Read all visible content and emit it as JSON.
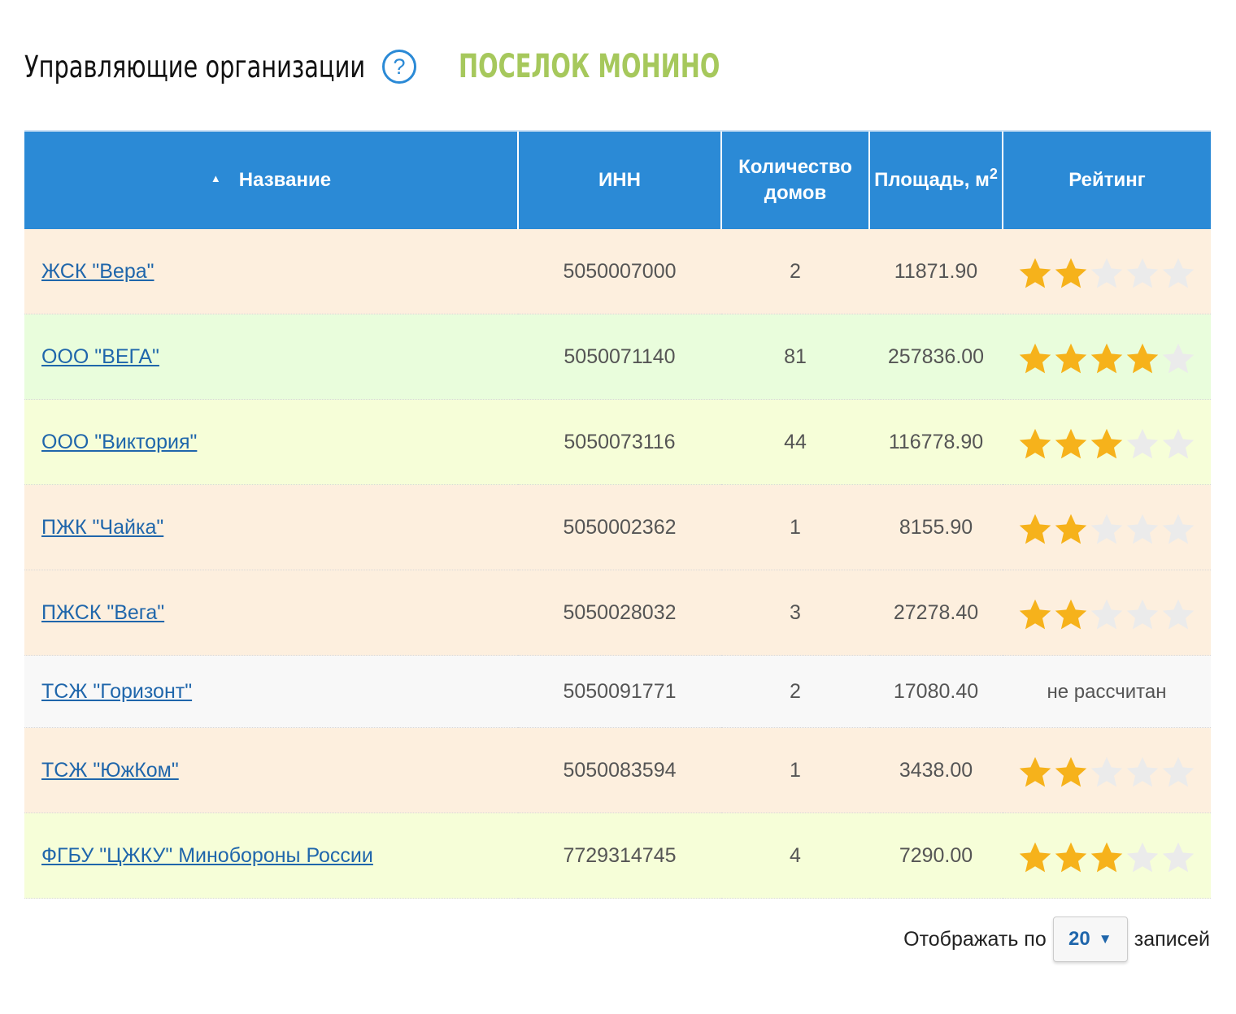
{
  "header": {
    "title": "Управляющие организации",
    "help_icon": "?",
    "locality": "ПОСЕЛОК МОНИНО"
  },
  "table": {
    "columns": {
      "name": "Название",
      "inn": "ИНН",
      "houses": "Количество домов",
      "area": "Площадь, м",
      "area_sup": "2",
      "rating": "Рейтинг"
    },
    "sort_indicator": "▲",
    "rows": [
      {
        "name": "ЖСК \"Вера\"",
        "inn": "5050007000",
        "houses": "2",
        "area": "11871.90",
        "rating": 2
      },
      {
        "name": "ООО \"ВЕГА\"",
        "inn": "5050071140",
        "houses": "81",
        "area": "257836.00",
        "rating": 4
      },
      {
        "name": "ООО \"Виктория\"",
        "inn": "5050073116",
        "houses": "44",
        "area": "116778.90",
        "rating": 3
      },
      {
        "name": "ПЖК \"Чайка\"",
        "inn": "5050002362",
        "houses": "1",
        "area": "8155.90",
        "rating": 2
      },
      {
        "name": "ПЖСК \"Вега\"",
        "inn": "5050028032",
        "houses": "3",
        "area": "27278.40",
        "rating": 2
      },
      {
        "name": "ТСЖ \"Горизонт\"",
        "inn": "5050091771",
        "houses": "2",
        "area": "17080.40",
        "rating": null,
        "rating_text": "не рассчитан"
      },
      {
        "name": "ТСЖ \"ЮжКом\"",
        "inn": "5050083594",
        "houses": "1",
        "area": "3438.00",
        "rating": 2
      },
      {
        "name": "ФГБУ \"ЦЖКУ\" Минобороны России",
        "inn": "7729314745",
        "houses": "4",
        "area": "7290.00",
        "rating": 3
      }
    ],
    "rating_max": 5
  },
  "pager": {
    "prefix": "Отображать по",
    "value": "20",
    "caret": "▼",
    "suffix": "записей"
  },
  "colors": {
    "header_blue": "#2b8ad6",
    "locality_green": "#a6c85c",
    "star_filled": "#f6b21b",
    "star_empty": "#ebebeb",
    "link": "#1f66ab"
  }
}
